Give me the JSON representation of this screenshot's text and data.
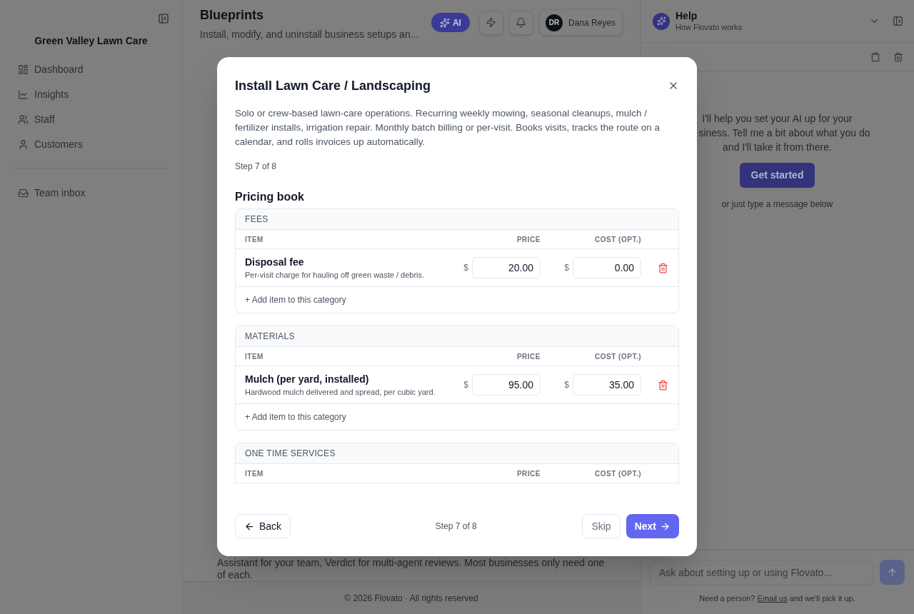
{
  "sidebar": {
    "org_name": "Green Valley Lawn Care",
    "nav": [
      {
        "label": "Dashboard"
      },
      {
        "label": "Insights"
      },
      {
        "label": "Staff"
      },
      {
        "label": "Customers"
      }
    ],
    "secondary_nav": [
      {
        "label": "Team inbox"
      }
    ]
  },
  "header": {
    "title": "Blueprints",
    "subtitle": "Install, modify, and uninstall business setups an...",
    "ai_button": "AI",
    "user": {
      "initials": "DR",
      "name": "Dana Reyes"
    }
  },
  "page_text": "Assistant for your team, Verdict for multi-agent reviews. Most businesses only need one of each.",
  "footer": "© 2026 Flovato · All rights reserved",
  "modal": {
    "title": "Install Lawn Care / Landscaping",
    "description": "Solo or crew-based lawn-care operations. Recurring weekly mowing, seasonal cleanups, mulch / fertilizer installs, irrigation repair. Monthly batch billing or per-visit. Books visits, tracks the route on a calendar, and rolls invoices up automatically.",
    "step_label": "Step 7 of 8",
    "section_title": "Pricing book",
    "categories": [
      {
        "name": "FEES",
        "columns": [
          "ITEM",
          "PRICE",
          "COST (OPT.)"
        ],
        "items": [
          {
            "name": "Disposal fee",
            "description": "Per-visit charge for hauling off green waste / debris.",
            "price_currency": "$",
            "price": "20.00",
            "cost_currency": "$",
            "cost": "0.00"
          }
        ],
        "add_label": "+ Add item to this category"
      },
      {
        "name": "MATERIALS",
        "columns": [
          "ITEM",
          "PRICE",
          "COST (OPT.)"
        ],
        "items": [
          {
            "name": "Mulch (per yard, installed)",
            "description": "Hardwood mulch delivered and spread, per cubic yard.",
            "price_currency": "$",
            "price": "95.00",
            "cost_currency": "$",
            "cost": "35.00"
          }
        ],
        "add_label": "+ Add item to this category"
      },
      {
        "name": "ONE TIME SERVICES",
        "columns": [
          "ITEM",
          "PRICE",
          "COST (OPT.)"
        ]
      }
    ],
    "footer": {
      "back": "Back",
      "step_label": "Step 7 of 8",
      "skip": "Skip",
      "next": "Next"
    }
  },
  "help": {
    "title": "Help",
    "subtitle": "How Flovato works",
    "intro_lines": [
      "I'll help you set your AI up for your",
      "siness. Tell me a bit about what you do",
      "and I'll take it from there."
    ],
    "cta": "Get started",
    "hint": "or just type a message below",
    "input": {
      "placeholder": "Ask about setting up or using Flovato..."
    },
    "note": {
      "before": "Need a person?",
      "link": "Email us",
      "after": "and we'll pick it up."
    }
  }
}
